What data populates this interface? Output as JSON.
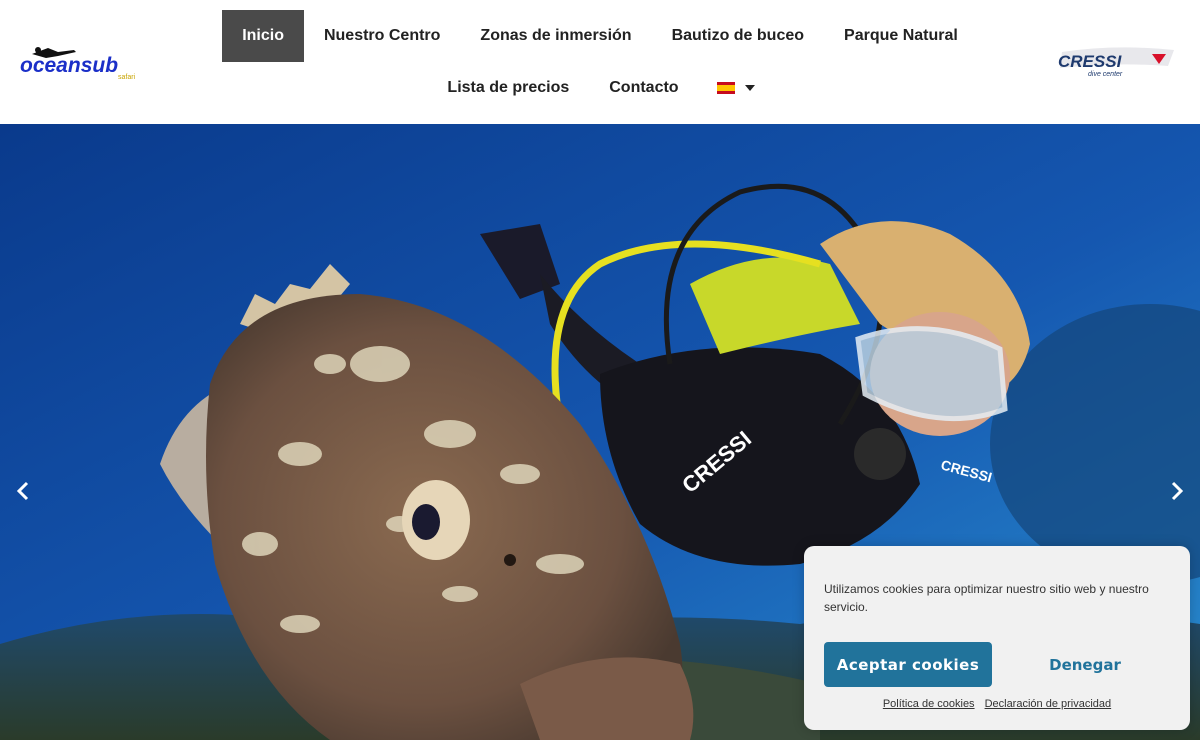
{
  "header": {
    "logo_left_text": "oceansub",
    "logo_left_sub": "safari",
    "logo_right_text": "CRESSI",
    "logo_right_sub": "dive center"
  },
  "nav": {
    "row1": [
      "Inicio",
      "Nuestro Centro",
      "Zonas de inmersión",
      "Bautizo de buceo",
      "Parque Natural"
    ],
    "row2": [
      "Lista de precios",
      "Contacto"
    ],
    "active": "Inicio",
    "language": "es"
  },
  "hero": {
    "wetsuit_text_1": "CRESSI",
    "wetsuit_text_2": "CRESSI"
  },
  "cookie_banner": {
    "message": "Utilizamos cookies para optimizar nuestro sitio web y nuestro servicio.",
    "accept_label": "Aceptar cookies",
    "deny_label": "Denegar",
    "policy_link": "Política de cookies",
    "privacy_link": "Declaración de privacidad"
  },
  "colors": {
    "accent": "#21739b",
    "nav_active_bg": "#4a4a4a",
    "water": "#0f4f9e"
  },
  "icons": [
    "chevron-left-icon",
    "chevron-right-icon",
    "spain-flag-icon",
    "caret-down-icon"
  ]
}
